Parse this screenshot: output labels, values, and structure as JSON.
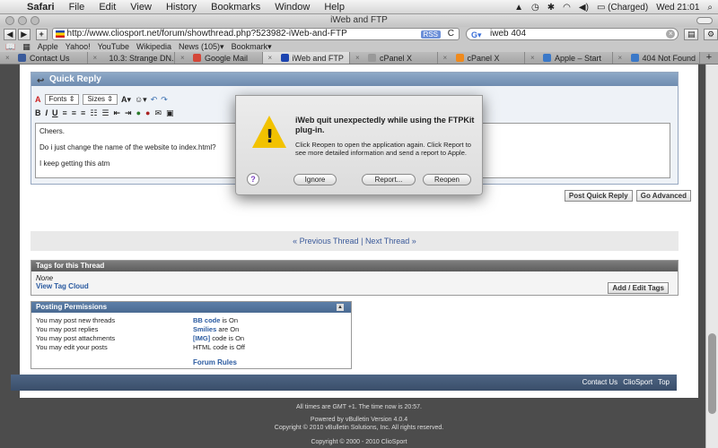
{
  "menubar": {
    "app": "Safari",
    "items": [
      "File",
      "Edit",
      "View",
      "History",
      "Bookmarks",
      "Window",
      "Help"
    ],
    "battery": "(Charged)",
    "clock": "Wed 21:01"
  },
  "window": {
    "title": "iWeb and FTP"
  },
  "toolbar": {
    "back": "◀",
    "forward": "▶",
    "plus": "+",
    "url": "http://www.cliosport.net/forum/showthread.php?523982-iWeb-and-FTP",
    "rss": "RSS",
    "reload": "C",
    "search_value": "iweb 404"
  },
  "bookmarks": [
    "Apple",
    "Yahoo!",
    "YouTube",
    "Wikipedia",
    "News (105)▾",
    "Bookmark▾"
  ],
  "tabs": [
    {
      "label": "Contact Us",
      "icon_color": "#3a5a9a",
      "active": false
    },
    {
      "label": "10.3: Strange DN...",
      "icon_color": "#777777",
      "active": false
    },
    {
      "label": "Google Mail",
      "icon_color": "#d44638",
      "active": false
    },
    {
      "label": "iWeb and FTP",
      "icon_color": "#1c44b0",
      "active": true
    },
    {
      "label": "cPanel X",
      "icon_color": "#999999",
      "active": false
    },
    {
      "label": "cPanel X",
      "icon_color": "#f08a1c",
      "active": false
    },
    {
      "label": "Apple – Start",
      "icon_color": "#3a78c8",
      "active": false
    },
    {
      "label": "404 Not Found",
      "icon_color": "#3a78c8",
      "active": false
    }
  ],
  "quick_reply": {
    "header": "Quick Reply",
    "font_select": "Fonts",
    "size_select": "Sizes",
    "format_buttons": [
      "B",
      "I",
      "U"
    ],
    "message_lines": [
      "Cheers.",
      "Do i just change the name of the website to index.html?",
      "I keep getting this atm"
    ],
    "post_button": "Post Quick Reply",
    "advanced_button": "Go Advanced"
  },
  "thread_nav": {
    "previous": "« Previous Thread",
    "separator": "|",
    "next": "Next Thread »"
  },
  "tags": {
    "header": "Tags for this Thread",
    "none_text": "None",
    "cloud_link": "View Tag Cloud",
    "edit_button": "Add / Edit Tags"
  },
  "permissions": {
    "header": "Posting Permissions",
    "left": [
      "You may post new threads",
      "You may post replies",
      "You may post attachments",
      "You may edit your posts"
    ],
    "right": [
      {
        "link": "BB code",
        "text": " is On"
      },
      {
        "link": "Smilies",
        "text": " are On"
      },
      {
        "link": "[IMG]",
        "text": " code is On"
      },
      {
        "link": "",
        "text": "HTML code is Off"
      }
    ],
    "rules_link": "Forum Rules"
  },
  "footer": {
    "links": [
      "Contact Us",
      "ClioSport",
      "Top"
    ]
  },
  "bottom": {
    "time": "All times are GMT +1. The time now is 20:57.",
    "powered": "Powered by vBulletin Version 4.0.4",
    "copyright1": "Copyright © 2010 vBulletin Solutions, Inc. All rights reserved.",
    "copyright2": "Copyright © 2000 - 2010 ClioSport"
  },
  "dialog": {
    "title": "iWeb quit unexpectedly while using the FTPKit plug-in.",
    "message": "Click Reopen to open the application again. Click Report to see more detailed information and send a report to Apple.",
    "help": "?",
    "ignore": "Ignore",
    "report": "Report...",
    "reopen": "Reopen"
  }
}
